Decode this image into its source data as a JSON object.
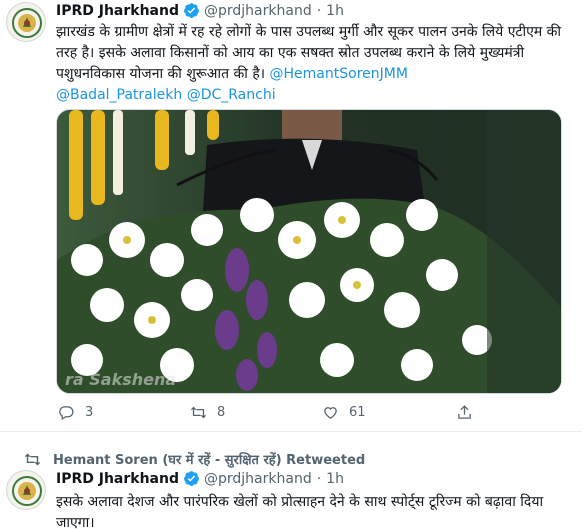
{
  "tweets": [
    {
      "author_name": "IPRD Jharkhand",
      "handle": "@prdjharkhand",
      "separator": "·",
      "time": "1h",
      "text": "झारखंड के ग्रामीण क्षेत्रों में रह रहे लोगों के पास उपलब्ध मुर्गी और सूकर पालन उनके लिये एटीएम की तरह है। इसके अलावा किसानों को आय का एक सषक्त स्रोत उपलब्ध कराने के लिये मुख्यमंत्री पशुधनविकास योजना की शुरूआत की है। ",
      "mentions": [
        "@HemantSorenJMM",
        "@Badal_Patralekh",
        "@DC_Ranchi"
      ],
      "media_watermark": "ra Sakshena",
      "reply_count": "3",
      "retweet_count": "8",
      "like_count": "61"
    },
    {
      "retweeted_by": "Hemant Soren (घर में रहें - सुरक्षित रहें) Retweeted",
      "author_name": "IPRD Jharkhand",
      "handle": "@prdjharkhand",
      "separator": "·",
      "time": "1h",
      "text": "इसके अलावा देशज और पारंपरिक खेलों को प्रोत्साहन देने के साथ स्पोर्ट्स टूरिज्म को बढ़ावा दिया जाएगा।"
    }
  ],
  "icons": {
    "verified": "verified-badge-icon",
    "reply": "reply-icon",
    "retweet": "retweet-icon",
    "like": "heart-icon",
    "share": "share-icon",
    "avatar": "jharkhand-emblem-avatar"
  },
  "colors": {
    "link": "#1b95e0",
    "verified": "#1da1f2",
    "secondary_text": "#536471"
  }
}
